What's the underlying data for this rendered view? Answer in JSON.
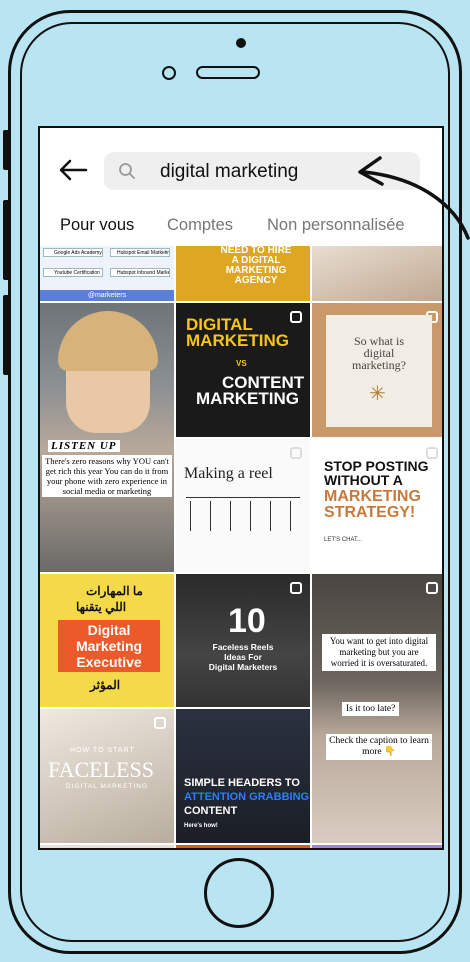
{
  "search": {
    "query": "digital marketing"
  },
  "tabs": [
    {
      "label": "Pour vous"
    },
    {
      "label": "Comptes"
    },
    {
      "label": "Non personnalisée"
    }
  ],
  "posts": {
    "p1": {
      "rows": [
        "Google Ads Academy",
        "Hubspot Email Marketing",
        "Youtube Certification",
        "Hubspot Inbound Marketing"
      ],
      "brand": "@marketers"
    },
    "p2": {
      "lines": [
        "NEED TO HIRE",
        "A DIGITAL",
        "MARKETING",
        "AGENCY"
      ]
    },
    "p4": {
      "caption_top": "LISTEN UP",
      "caption": "There's zero reasons why YOU can't get rich this year You can do it from your phone with zero experience in social media or marketing"
    },
    "p5": {
      "line1": "DIGITAL",
      "line2": "MARKETING",
      "vs": "VS",
      "line3": "CONTENT",
      "line4": "MARKETING"
    },
    "p6": {
      "line1": "So what is",
      "line2": "digital",
      "line3": "marketing?"
    },
    "p8": {
      "title": "Making a reel"
    },
    "p9": {
      "l1": "STOP POSTING",
      "l2": "WITHOUT A",
      "l3": "MARKETING",
      "l4": "STRATEGY!",
      "sub": "LET'S CHAT..."
    },
    "p10": {
      "ar1": "ما المهارات",
      "ar2": "اللي يتقنها",
      "en1": "Digital",
      "en2": "Marketing",
      "en3": "Executive",
      "ar3": "المؤثر"
    },
    "p11": {
      "num": "10",
      "l1": "Faceless Reels",
      "l2": "Ideas For",
      "l3": "Digital Marketers"
    },
    "p12": {
      "l1": "You want to get into digital marketing but you are worried it is oversaturated.",
      "l2": "Is it too late?",
      "l3": "Check the caption to learn more 👇"
    },
    "p13": {
      "small": "HOW TO START",
      "big": "FACELESS",
      "sub": "DIGITAL MARKETING"
    },
    "p14": {
      "l1": "SIMPLE HEADERS TO",
      "l2": "ATTENTION GRABBING",
      "l3": "CONTENT",
      "sub": "Here's how!"
    }
  },
  "colors": {
    "background": "#b9e5f2",
    "accent_yellow": "#f5c518",
    "accent_blue": "#2d7ff9"
  }
}
